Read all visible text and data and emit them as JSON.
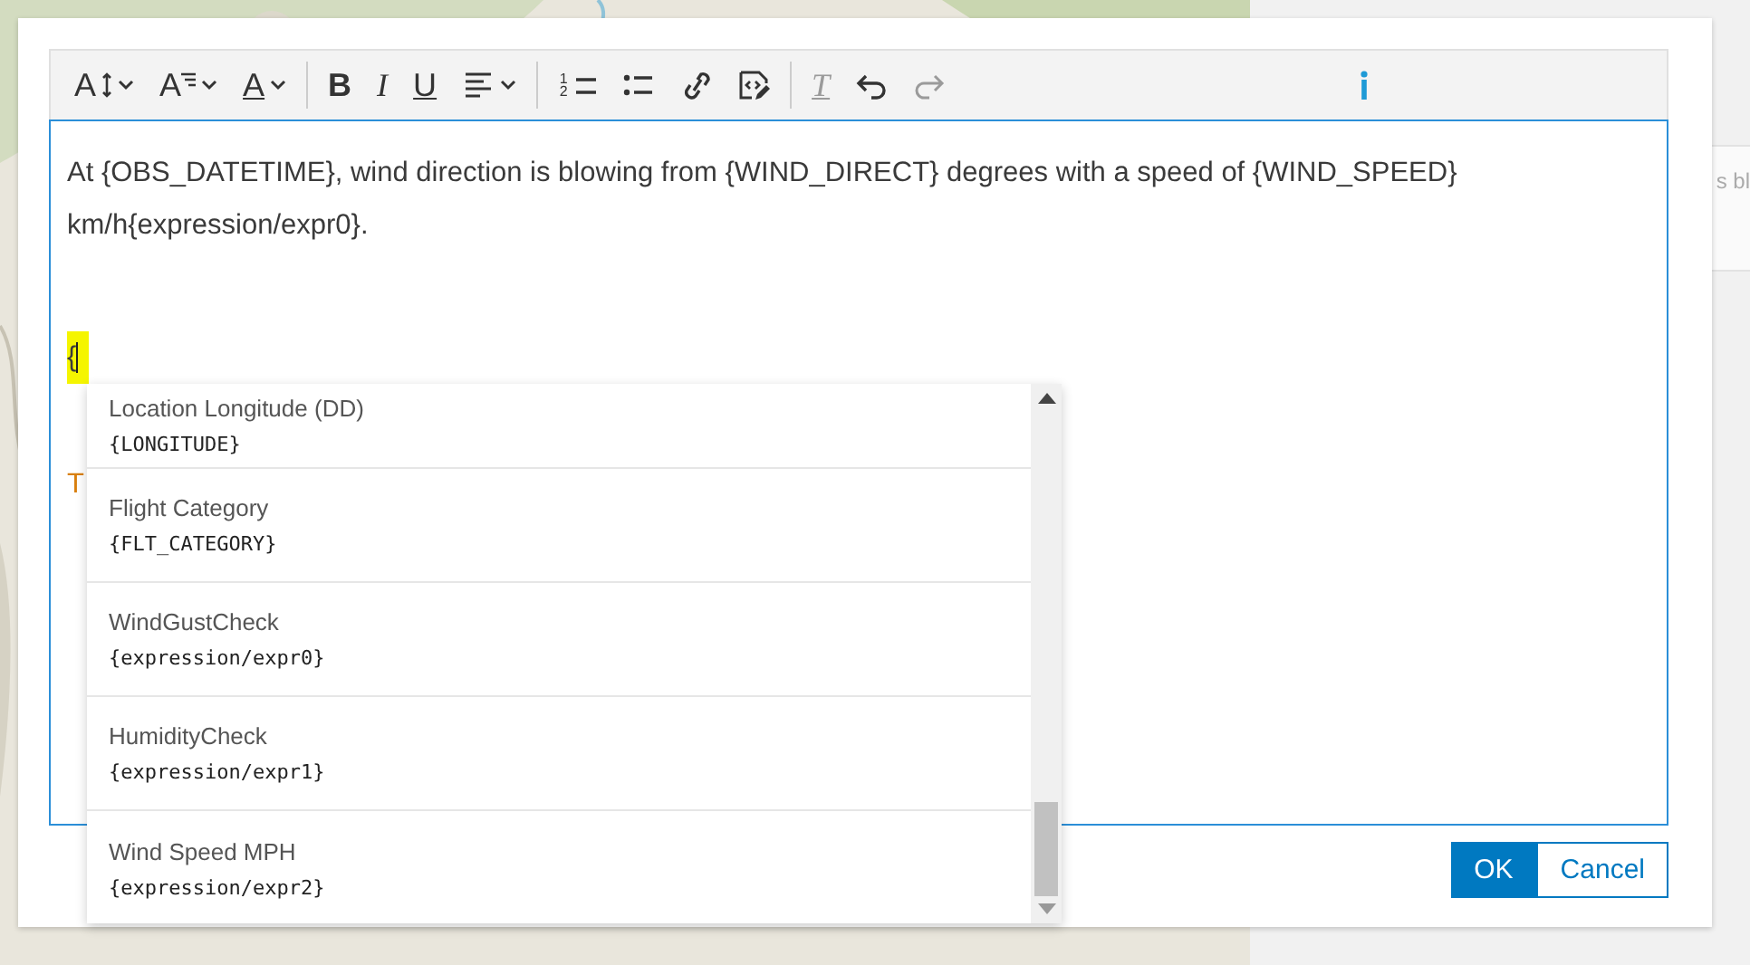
{
  "background": {
    "panel_text": "s bl"
  },
  "dialog": {
    "toolbar": [
      {
        "kind": "font-size",
        "glyph": "A",
        "dropdown": true,
        "disabled": false
      },
      {
        "kind": "text-style",
        "glyph": "A",
        "dropdown": true,
        "disabled": false
      },
      {
        "kind": "font-color",
        "glyph": "A",
        "dropdown": true,
        "disabled": false
      },
      {
        "kind": "divider"
      },
      {
        "kind": "bold",
        "glyph": "B",
        "dropdown": false,
        "disabled": false
      },
      {
        "kind": "italic",
        "glyph": "I",
        "dropdown": false,
        "disabled": false
      },
      {
        "kind": "underline",
        "glyph": "U",
        "dropdown": false,
        "disabled": false
      },
      {
        "kind": "align",
        "dropdown": true,
        "disabled": false
      },
      {
        "kind": "divider"
      },
      {
        "kind": "numbered-list",
        "glyph": "12",
        "dropdown": false,
        "disabled": false
      },
      {
        "kind": "bullet-list",
        "dropdown": false,
        "disabled": false
      },
      {
        "kind": "link",
        "dropdown": false,
        "disabled": false
      },
      {
        "kind": "code",
        "dropdown": false,
        "disabled": false
      },
      {
        "kind": "divider"
      },
      {
        "kind": "clear-format",
        "glyph": "T",
        "dropdown": false,
        "disabled": true
      },
      {
        "kind": "undo",
        "dropdown": false,
        "disabled": false
      },
      {
        "kind": "redo",
        "dropdown": false,
        "disabled": true
      },
      {
        "kind": "info"
      }
    ],
    "editor": {
      "paragraphs": [
        {
          "kind": "text",
          "lines": [
            "At {OBS_DATETIME}, wind direction is blowing from {WIND_DIRECT} degrees with a speed of {WIND_SPEED}",
            "km/h{expression/expr0}."
          ]
        },
        {
          "kind": "trigger",
          "lines": [
            "{"
          ]
        },
        {
          "kind": "note",
          "lines": [
            "T"
          ]
        }
      ]
    },
    "autocomplete": {
      "items": [
        {
          "label": "Location Longitude (DD)",
          "field": "{LONGITUDE}"
        },
        {
          "label": "Flight Category",
          "field": "{FLT_CATEGORY}"
        },
        {
          "label": "WindGustCheck",
          "field": "{expression/expr0}"
        },
        {
          "label": "HumidityCheck",
          "field": "{expression/expr1}"
        },
        {
          "label": "Wind Speed MPH",
          "field": "{expression/expr2}"
        }
      ]
    },
    "buttons": [
      {
        "label": "OK",
        "kind": "primary"
      },
      {
        "label": "Cancel",
        "kind": "secondary"
      }
    ]
  }
}
